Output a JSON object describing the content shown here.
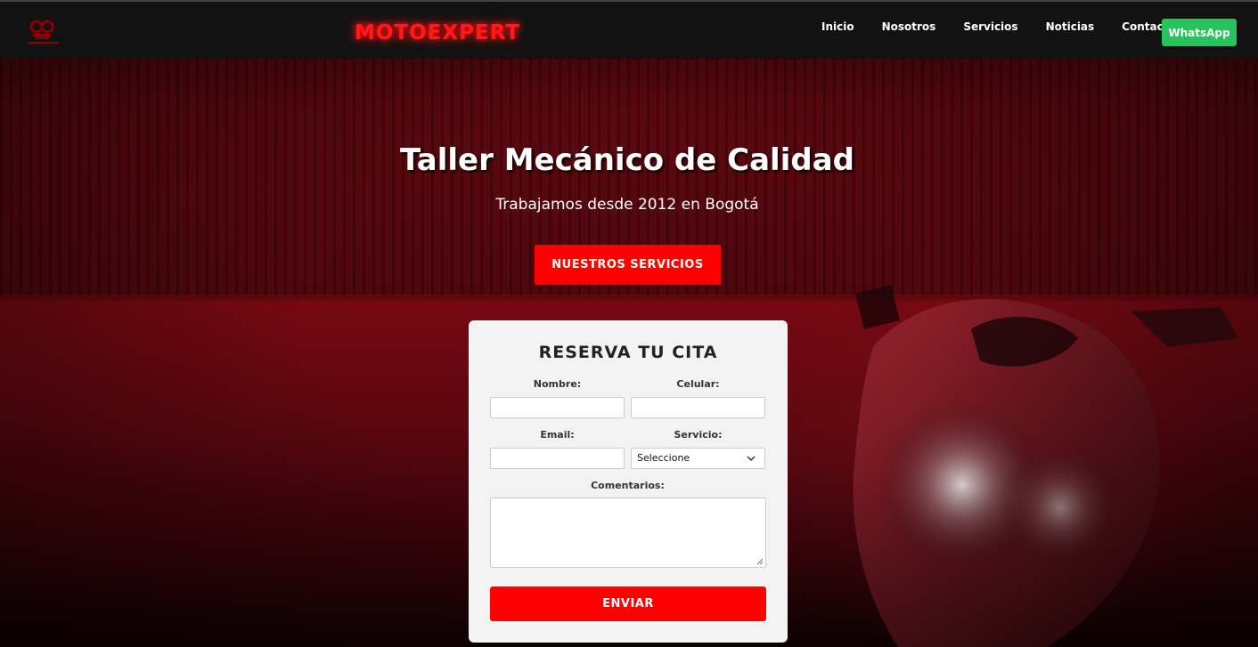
{
  "navbar": {
    "logo_icon": "motorcycle-logo-icon",
    "brand": "MOTOEXPERT",
    "links": [
      {
        "label": "Inicio"
      },
      {
        "label": "Nosotros"
      },
      {
        "label": "Servicios"
      },
      {
        "label": "Noticias"
      },
      {
        "label": "Contacto"
      }
    ],
    "whatsapp_label": "WhatsApp"
  },
  "hero": {
    "title": "Taller Mecánico de Calidad",
    "subtitle": "Trabajamos desde 2012 en Bogotá",
    "cta_label": "NUESTROS SERVICIOS"
  },
  "form": {
    "title": "RESERVA TU CITA",
    "name_label": "Nombre:",
    "name_value": "",
    "phone_label": "Celular:",
    "phone_value": "",
    "email_label": "Email:",
    "email_value": "",
    "service_label": "Servicio:",
    "service_selected": "Seleccione",
    "comments_label": "Comentarios:",
    "comments_value": "",
    "submit_label": "ENVIAR"
  },
  "colors": {
    "accent": "#ff0000",
    "whatsapp": "#25c45c",
    "navbar": "#121212"
  }
}
